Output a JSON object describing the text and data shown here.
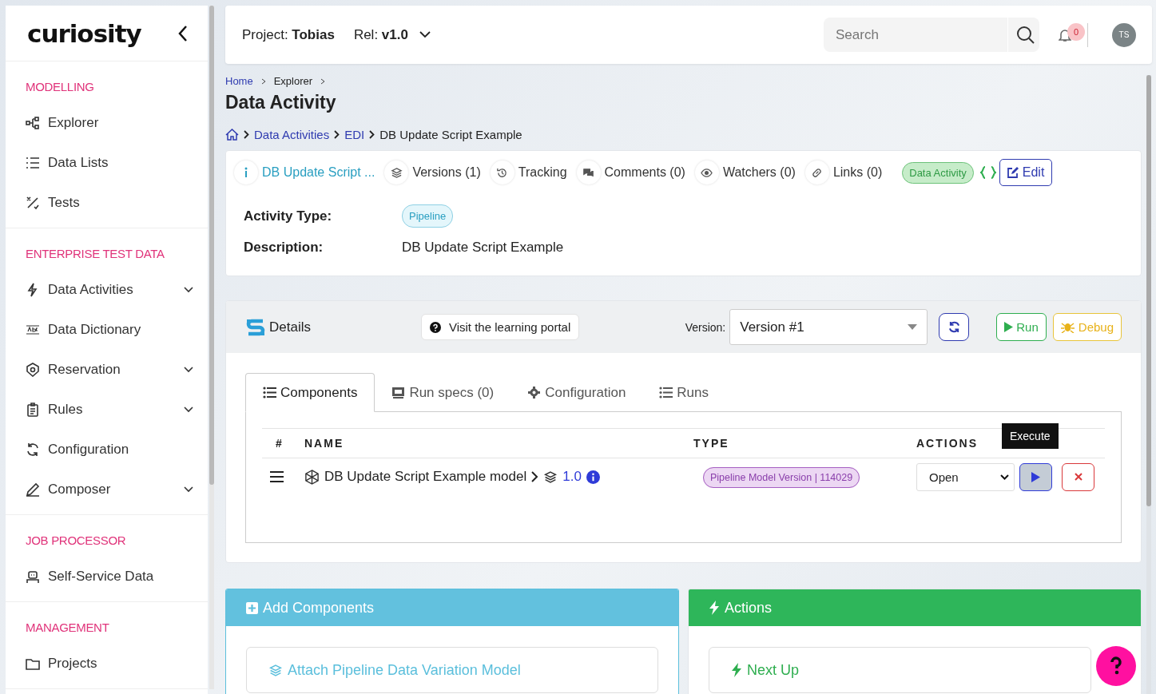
{
  "sidebar": {
    "logo": "curiosity",
    "sections": [
      {
        "title": "MODELLING",
        "items": [
          {
            "label": "Explorer",
            "has_submenu": false
          },
          {
            "label": "Data Lists",
            "has_submenu": false
          },
          {
            "label": "Tests",
            "has_submenu": false
          }
        ]
      },
      {
        "title": "ENTERPRISE TEST DATA",
        "items": [
          {
            "label": "Data Activities",
            "has_submenu": true
          },
          {
            "label": "Data Dictionary",
            "has_submenu": false
          },
          {
            "label": "Reservation",
            "has_submenu": true
          },
          {
            "label": "Rules",
            "has_submenu": true
          },
          {
            "label": "Configuration",
            "has_submenu": false
          },
          {
            "label": "Composer",
            "has_submenu": true
          }
        ]
      },
      {
        "title": "JOB PROCESSOR",
        "items": [
          {
            "label": "Self-Service Data",
            "has_submenu": false
          }
        ]
      },
      {
        "title": "MANAGEMENT",
        "items": [
          {
            "label": "Projects",
            "has_submenu": false
          }
        ]
      }
    ]
  },
  "topbar": {
    "project": "Project: **Tobias**",
    "release": "Rel: **v1.0**",
    "search": {
      "placeholder": "Search"
    },
    "notifications": "0",
    "avatar": "TS"
  },
  "breadcrumb": [
    "Home",
    "Explorer"
  ],
  "page_title": "Data Activity",
  "path": [
    "Data Activities",
    "EDI",
    "DB Update Script Example"
  ],
  "card": {
    "tabs": [
      {
        "label": "DB Update Script ...",
        "selected": true
      },
      {
        "label": "Versions (1)",
        "selected": false
      },
      {
        "label": "Tracking",
        "selected": false
      },
      {
        "label": "Comments (0)",
        "selected": false
      },
      {
        "label": "Watchers (0)",
        "selected": false
      },
      {
        "label": "Links (0)",
        "selected": false
      }
    ],
    "badge": "Data Activity",
    "edit": "Edit",
    "fields": [
      {
        "label": "Activity Type:",
        "value": "Pipeline",
        "kind": "badge"
      },
      {
        "label": "Description:",
        "value": "DB Update Script Example",
        "kind": "text"
      }
    ]
  },
  "details": {
    "title": "Details",
    "portal": "Visit the learning portal",
    "version_label": "Version:",
    "version": "Version #1",
    "run": "Run",
    "debug": "Debug",
    "tabs": [
      {
        "label": "Components",
        "selected": true
      },
      {
        "label": "Run specs (0)",
        "selected": false
      },
      {
        "label": "Configuration",
        "selected": false
      },
      {
        "label": "Runs",
        "selected": false
      }
    ],
    "table": {
      "columns": [
        "#",
        "NAME",
        "TYPE",
        "ACTIONS"
      ],
      "rows": [
        {
          "name": "DB Update Script Example model",
          "version": "1.0",
          "type": "Pipeline Model Version | 114029",
          "action": "Open"
        }
      ]
    },
    "tooltip": "Execute"
  },
  "panels": [
    {
      "title": "Add Components",
      "kind": "add",
      "items": [
        "Attach Pipeline Data Variation Model"
      ]
    },
    {
      "title": "Actions",
      "kind": "actions",
      "items": [
        "Next Up"
      ]
    }
  ]
}
